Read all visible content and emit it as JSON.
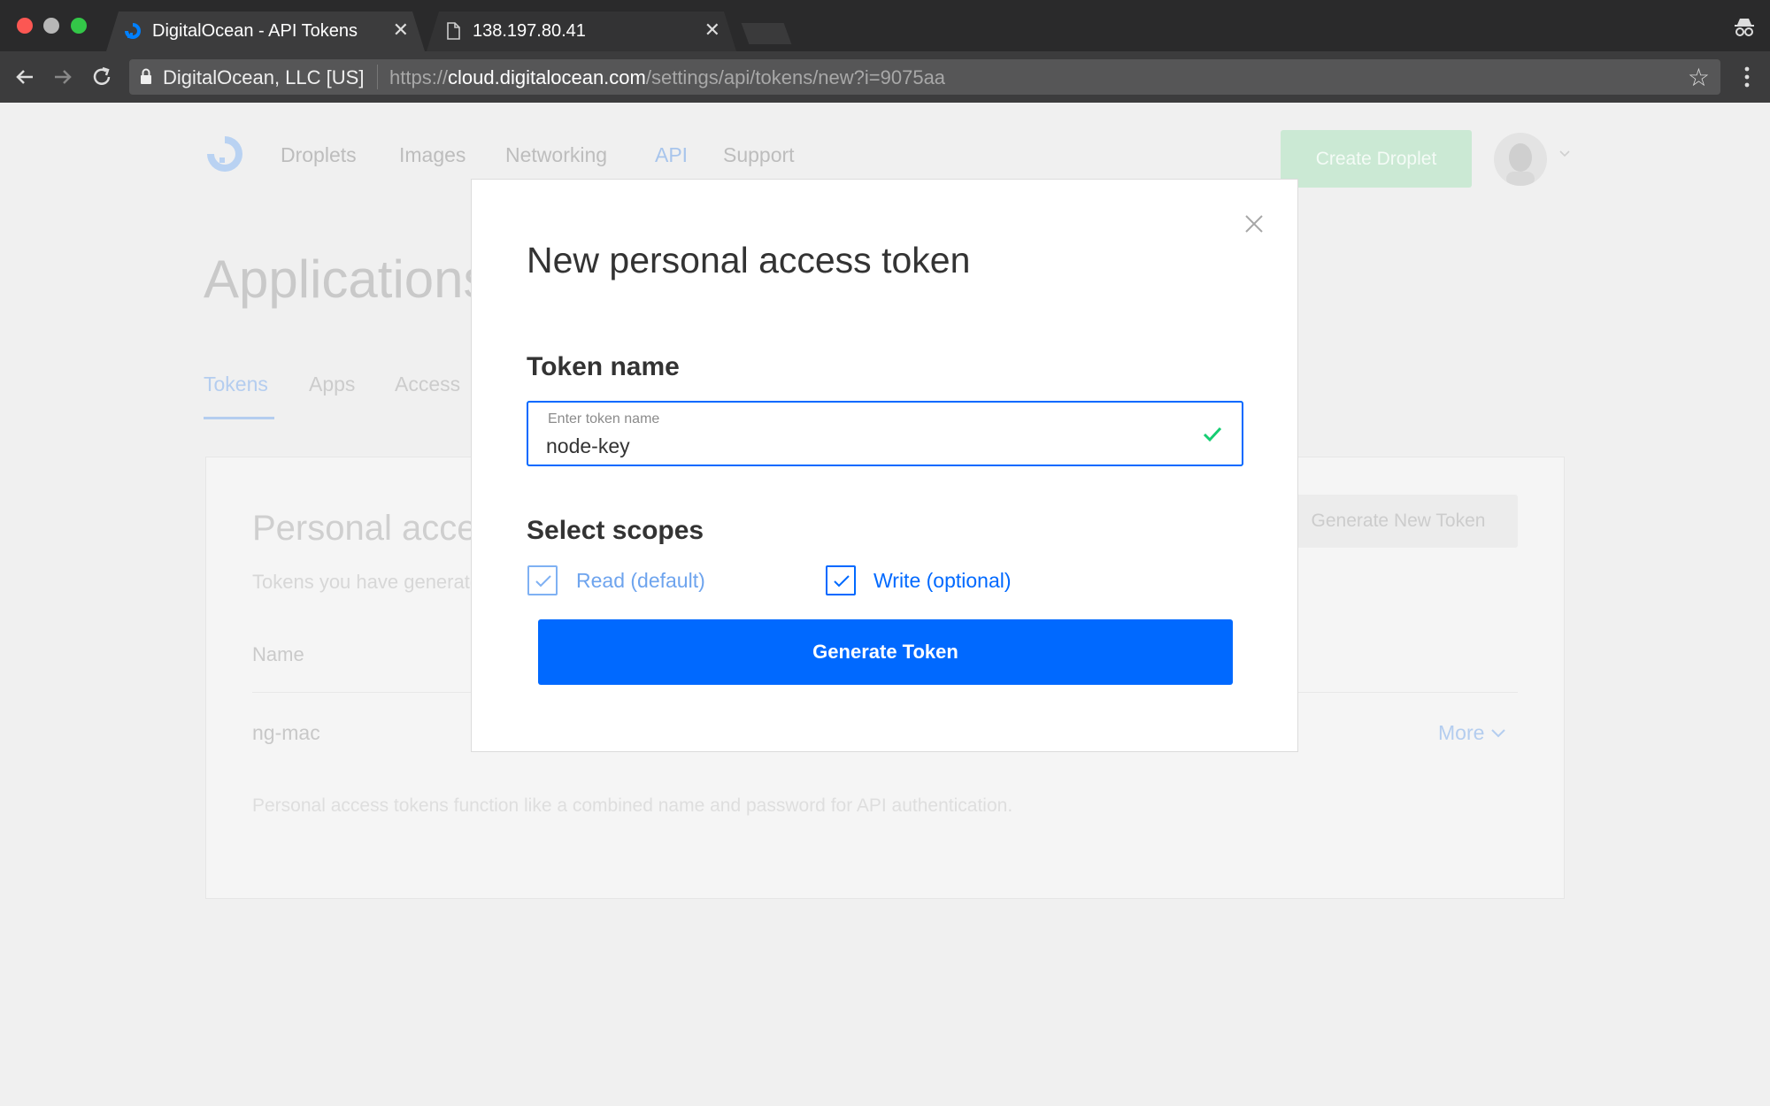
{
  "browser": {
    "tabs": [
      {
        "title": "DigitalOcean - API Tokens",
        "active": true
      },
      {
        "title": "138.197.80.41",
        "active": false
      }
    ],
    "close_glyph": "✕",
    "origin_label": "DigitalOcean, LLC [US]",
    "url_scheme": "https://",
    "url_host": "cloud.digitalocean.com",
    "url_path": "/settings/api/tokens/new?i=9075aa"
  },
  "app": {
    "nav": [
      "Droplets",
      "Images",
      "Networking",
      "API",
      "Support"
    ],
    "active_nav": "API",
    "create_button": "Create Droplet"
  },
  "page": {
    "title": "Applications",
    "tabs": [
      "Tokens",
      "Apps",
      "Access"
    ],
    "active_tab": "Tokens",
    "panel": {
      "title": "Personal access tokens",
      "subtitle": "Tokens you have generated to access the DigitalOcean API.",
      "generate_button": "Generate New Token",
      "column_name": "Name",
      "rows": [
        {
          "name": "ng-mac",
          "action": "More"
        }
      ],
      "note": "Personal access tokens function like a combined name and password for API authentication."
    }
  },
  "modal": {
    "title": "New personal access token",
    "token_name_label": "Token name",
    "field_label": "Enter token name",
    "field_value": "node-key",
    "scopes_label": "Select scopes",
    "scopes": [
      {
        "label": "Read (default)",
        "checked": true
      },
      {
        "label": "Write (optional)",
        "checked": true
      }
    ],
    "submit": "Generate Token"
  },
  "colors": {
    "primary": "#0069ff",
    "success": "#15cd72",
    "create_droplet": "#15cd72"
  },
  "icons": [
    "back-arrow-icon",
    "forward-arrow-icon",
    "reload-icon",
    "lock-icon",
    "star-icon",
    "menu-dots-icon",
    "incognito-icon",
    "digitalocean-logo-icon",
    "close-icon",
    "checkmark-icon",
    "chevron-down-icon"
  ]
}
